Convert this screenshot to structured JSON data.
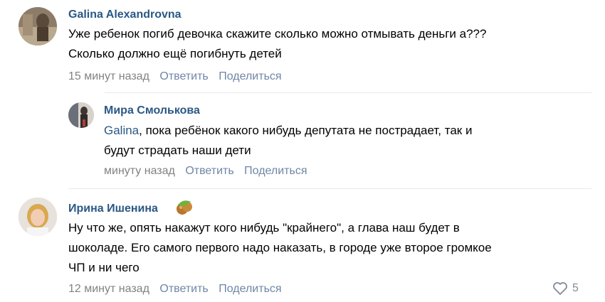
{
  "comments": [
    {
      "author": "Galina Alexandrovna",
      "lines": [
        "Уже ребенок погиб девочка скажите сколько можно отмывать деньги а???",
        "Сколько должно ещё погибнуть детей"
      ],
      "time": "15 минут назад",
      "reply_label": "Ответить",
      "share_label": "Поделиться"
    },
    {
      "author": "Мира Смолькова",
      "mention": "Galina",
      "lines": [
        ", пока ребёнок какого нибудь депутата не пострадает, так и",
        "будут страдать наши дети"
      ],
      "time": "минуту назад",
      "reply_label": "Ответить",
      "share_label": "Поделиться"
    },
    {
      "author": "Ирина Ишенина",
      "badge_icon": "hazelnut-icon",
      "lines": [
        "Ну что же, опять накажут кого нибудь \"крайнего\", а глава наш будет в",
        "шоколаде. Его самого первого надо наказать, в городе уже второе громкое",
        "ЧП и ни чего"
      ],
      "time": "12 минут назад",
      "reply_label": "Ответить",
      "share_label": "Поделиться",
      "likes": "5"
    }
  ],
  "colors": {
    "author": "#2a5885",
    "meta": "#828282",
    "action": "#6f86a6",
    "divider": "#e7e8ec"
  }
}
